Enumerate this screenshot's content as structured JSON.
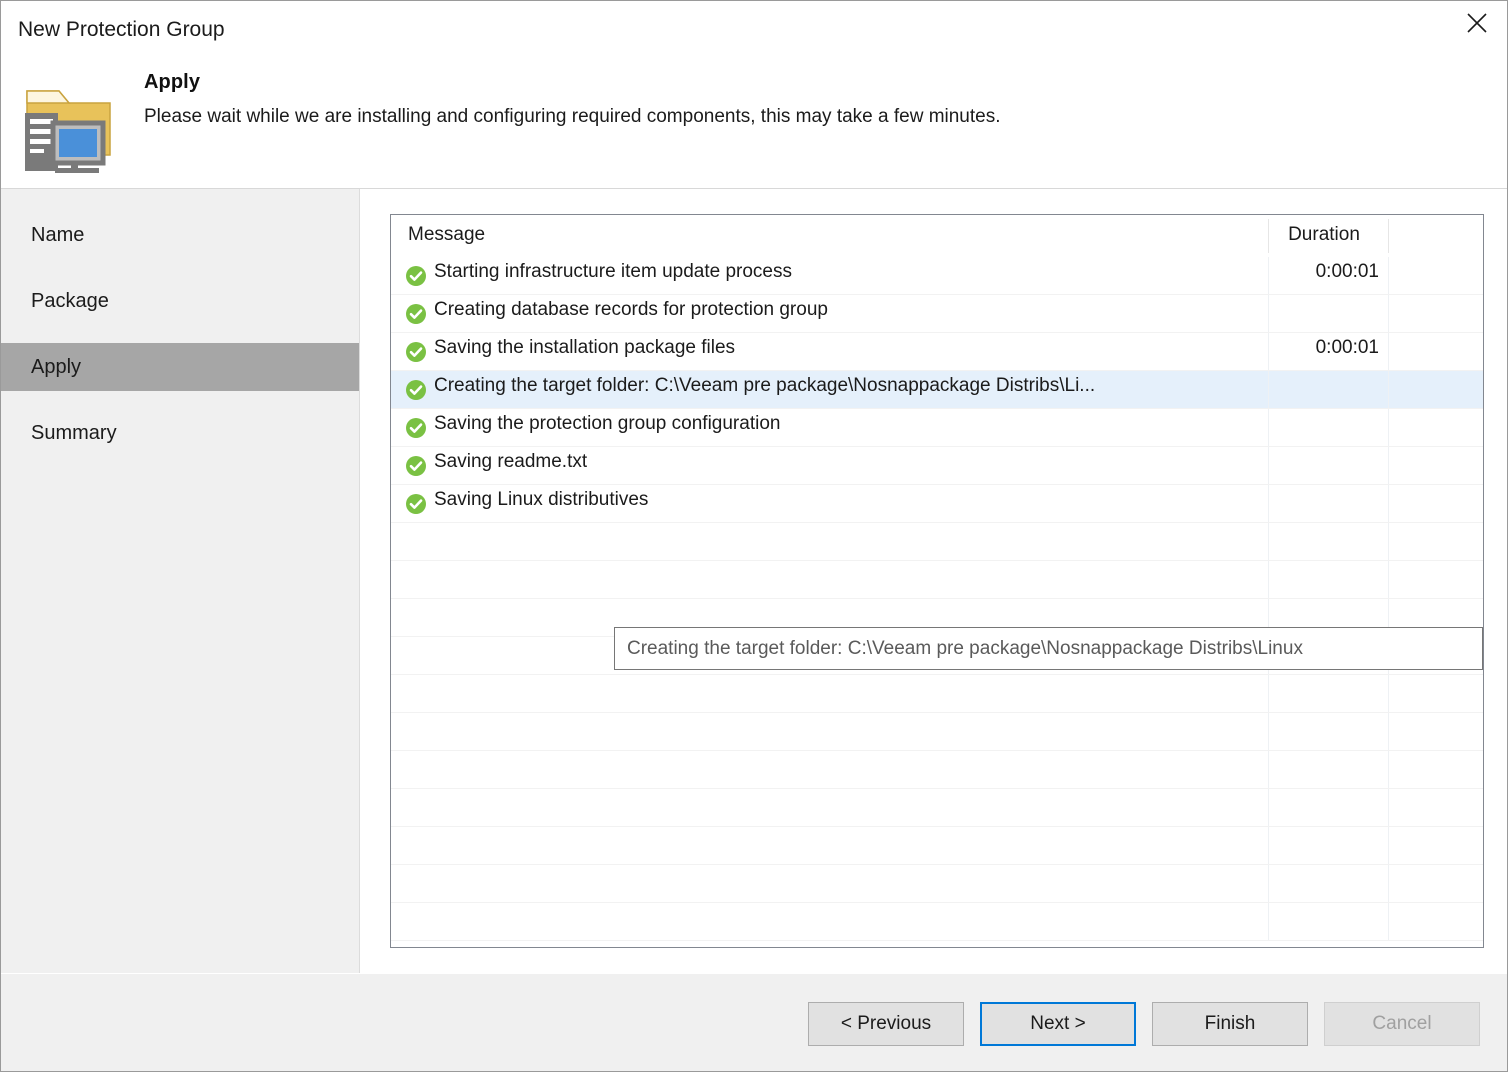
{
  "window": {
    "title": "New Protection Group",
    "close_icon": "close-icon"
  },
  "header": {
    "icon": "protection-group-folder-icon",
    "title": "Apply",
    "subtitle": "Please wait while we are installing and configuring required components, this may take a few minutes."
  },
  "sidebar": {
    "items": [
      {
        "label": "Name",
        "selected": false
      },
      {
        "label": "Package",
        "selected": false
      },
      {
        "label": "Apply",
        "selected": true
      },
      {
        "label": "Summary",
        "selected": false
      }
    ]
  },
  "list": {
    "columns": {
      "message": "Message",
      "duration": "Duration"
    },
    "rows": [
      {
        "icon": "success-check-icon",
        "message": "Starting infrastructure item update process",
        "duration": "0:00:01",
        "selected": false
      },
      {
        "icon": "success-check-icon",
        "message": "Creating database records for protection group",
        "duration": "",
        "selected": false
      },
      {
        "icon": "success-check-icon",
        "message": "Saving the installation package files",
        "duration": "0:00:01",
        "selected": false
      },
      {
        "icon": "success-check-icon",
        "message": "Creating the target folder: C:\\Veeam pre package\\Nosnappackage Distribs\\Li...",
        "duration": "",
        "selected": true
      },
      {
        "icon": "success-check-icon",
        "message": "Saving the protection group configuration",
        "duration": "",
        "selected": false
      },
      {
        "icon": "success-check-icon",
        "message": "Saving readme.txt",
        "duration": "",
        "selected": false
      },
      {
        "icon": "success-check-icon",
        "message": "Saving Linux distributives",
        "duration": "",
        "selected": false
      }
    ],
    "empty_row_count": 11
  },
  "tooltip": {
    "text": "Creating the target folder: C:\\Veeam pre package\\Nosnappackage Distribs\\Linux"
  },
  "footer": {
    "buttons": [
      {
        "id": "previous",
        "label": "< Previous",
        "state": "enabled"
      },
      {
        "id": "next",
        "label": "Next >",
        "state": "default"
      },
      {
        "id": "finish",
        "label": "Finish",
        "state": "enabled"
      },
      {
        "id": "cancel",
        "label": "Cancel",
        "state": "disabled"
      }
    ]
  },
  "colors": {
    "accent": "#0078d7",
    "success": "#7ac143",
    "selection": "#e5f0fb",
    "sidebar_selected": "#a6a6a6",
    "folder": "#e8c25a"
  }
}
